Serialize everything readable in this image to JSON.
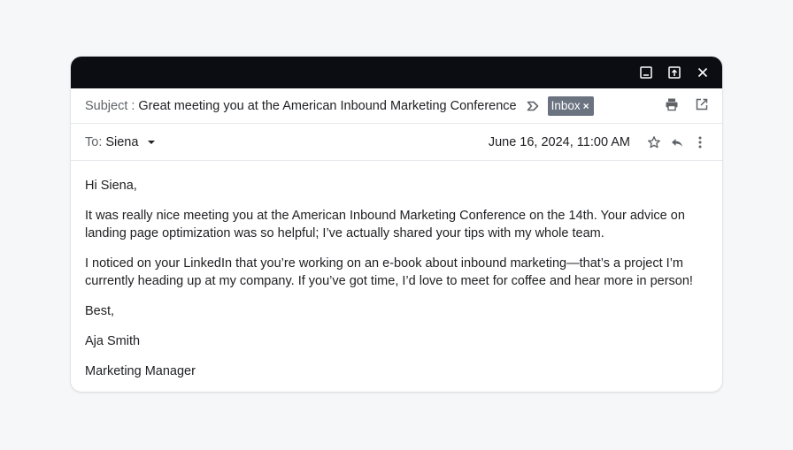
{
  "window": {
    "controls": {
      "minimize_icon": "minimize-icon",
      "popout_icon": "popout-icon",
      "close_icon": "close-icon"
    }
  },
  "email": {
    "subject_label": "Subject",
    "subject_separator": ":",
    "subject": "Great meeting you at the American Inbound Marketing Conference",
    "label_chip": "Inbox",
    "label_chip_close": "×",
    "to_label": "To:",
    "to_name": "Siena",
    "date": "June 16, 2024, 11:00 AM",
    "greeting": "Hi Siena,",
    "paragraphs": [
      "It was really nice meeting you at the American Inbound Marketing Conference on the 14th. Your advice on landing page optimization was so helpful; I’ve actually shared your tips with my whole team.",
      "I noticed on your LinkedIn that you’re working on an e-book about inbound marketing—that’s a project I’m currently heading up at my company. If you’ve got time, I’d love to meet for coffee and hear more in person!"
    ],
    "signoff": "Best,",
    "sender_name": "Aja Smith",
    "sender_title": "Marketing Manager"
  },
  "colors": {
    "page_background": "#f6f7f9",
    "titlebar": "#0b0d12",
    "chip_background": "#6b7280",
    "muted_text": "#5f6368",
    "text": "#202124"
  }
}
